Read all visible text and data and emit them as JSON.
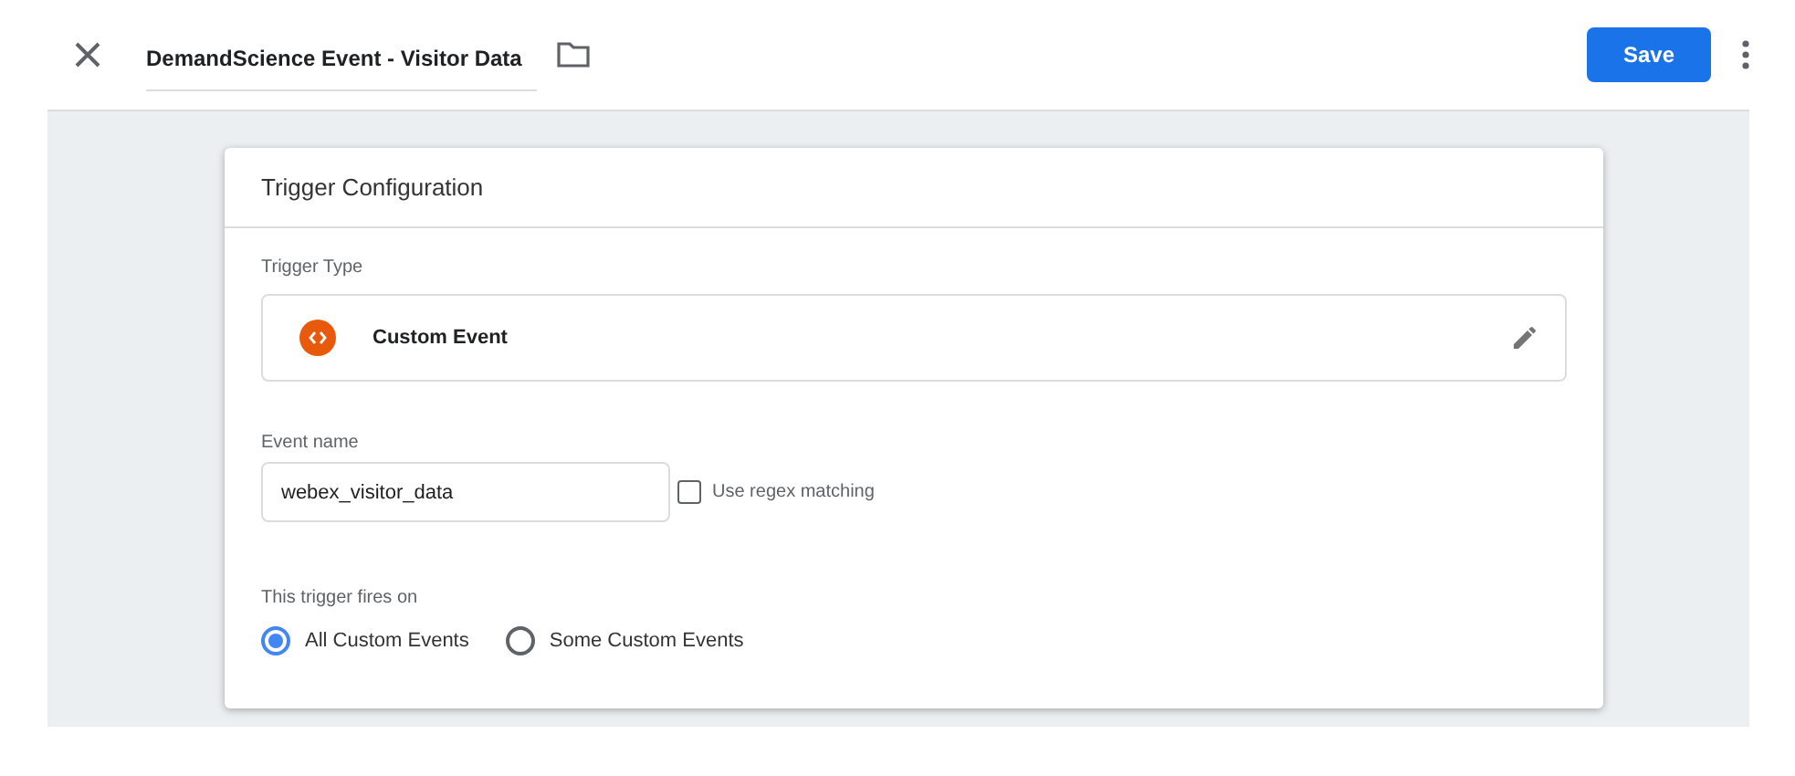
{
  "header": {
    "title": "DemandScience Event - Visitor Data",
    "save_label": "Save"
  },
  "card": {
    "title": "Trigger Configuration",
    "trigger_type": {
      "label": "Trigger Type",
      "value": "Custom Event"
    },
    "event_name": {
      "label": "Event name",
      "value": "webex_visitor_data",
      "regex": {
        "label": "Use regex matching",
        "checked": false
      }
    },
    "fires_on": {
      "label": "This trigger fires on",
      "options": [
        {
          "label": "All Custom Events",
          "selected": true
        },
        {
          "label": "Some Custom Events",
          "selected": false
        }
      ]
    }
  }
}
